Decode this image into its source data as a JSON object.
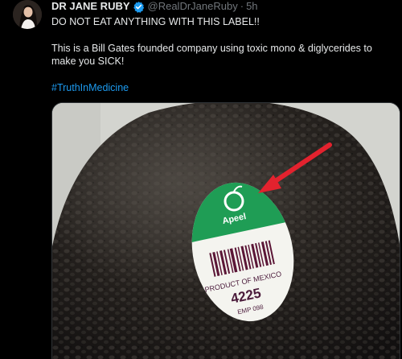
{
  "tweet": {
    "display_name": "DR JANE RUBY",
    "handle": "@RealDrJaneRuby",
    "separator": "·",
    "time": "5h",
    "line1": "DO NOT EAT ANYTHING WITH THIS LABEL!!",
    "line2": "This is a Bill Gates founded company using toxic mono & diglycerides to",
    "line3": "make you SICK!",
    "hashtag": "#TruthInMedicine"
  },
  "media": {
    "sticker_brand": "Apeel",
    "sticker_origin": "PRODUCT OF MEXICO",
    "sticker_plu": "4225",
    "sticker_code": "EMP 098"
  },
  "colors": {
    "background": "#000000",
    "text": "#e7e9ea",
    "muted": "#71767b",
    "link": "#1d9bf0",
    "verified": "#1d9bf0",
    "arrow": "#e3222e",
    "sticker_green": "#1f9d55"
  },
  "icons": {
    "verified": "verified-badge-icon",
    "arrow": "red-arrow-icon",
    "logo": "apeel-logo-icon"
  }
}
